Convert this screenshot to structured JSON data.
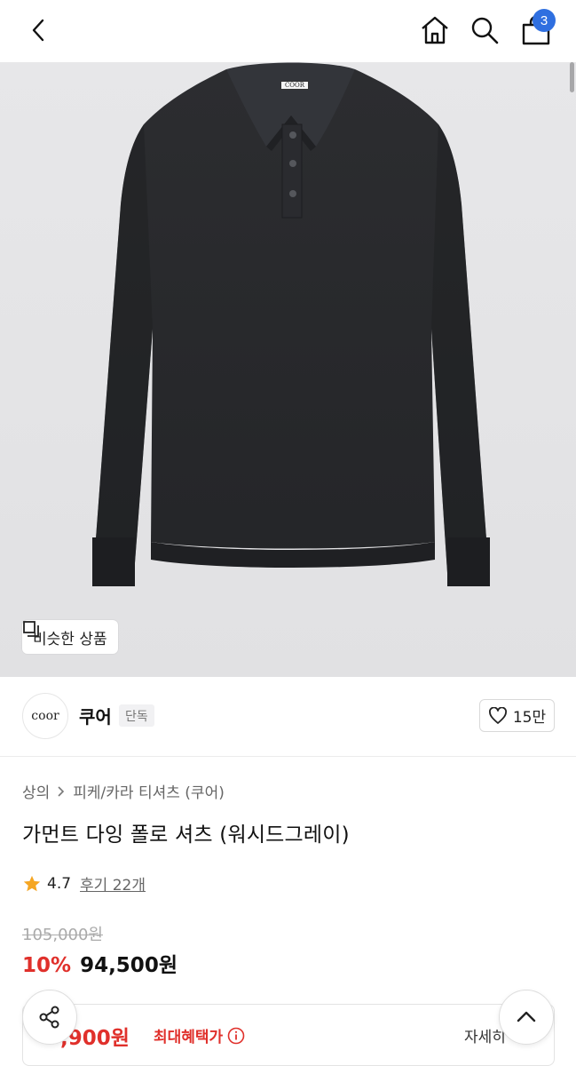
{
  "header": {
    "back_icon": "chevron-left-icon",
    "home_icon": "home-icon",
    "search_icon": "search-icon",
    "cart_icon": "shopping-bag-icon",
    "cart_count": "3"
  },
  "product_image": {
    "label_on_collar": "COOR",
    "similar_label": "비슷한 상품"
  },
  "brand": {
    "logo_text": "coor",
    "name": "쿠어",
    "tag": "단독",
    "like_count": "15만"
  },
  "product": {
    "category_1": "상의",
    "category_2": "피케/카라 티셔츠 (쿠어)",
    "title": "가먼트 다잉 폴로 셔츠 (워시드그레이)",
    "rating": "4.7",
    "reviews": "후기 22개",
    "original_price": "105,000원",
    "discount": "10%",
    "sale_price": "94,500원"
  },
  "benefit": {
    "price": ",900원",
    "label": "최대혜택가",
    "detail": "자세히"
  },
  "colors": {
    "accent_red": "#e0302b",
    "badge_blue": "#2f6fe0",
    "star": "#f5a623"
  }
}
